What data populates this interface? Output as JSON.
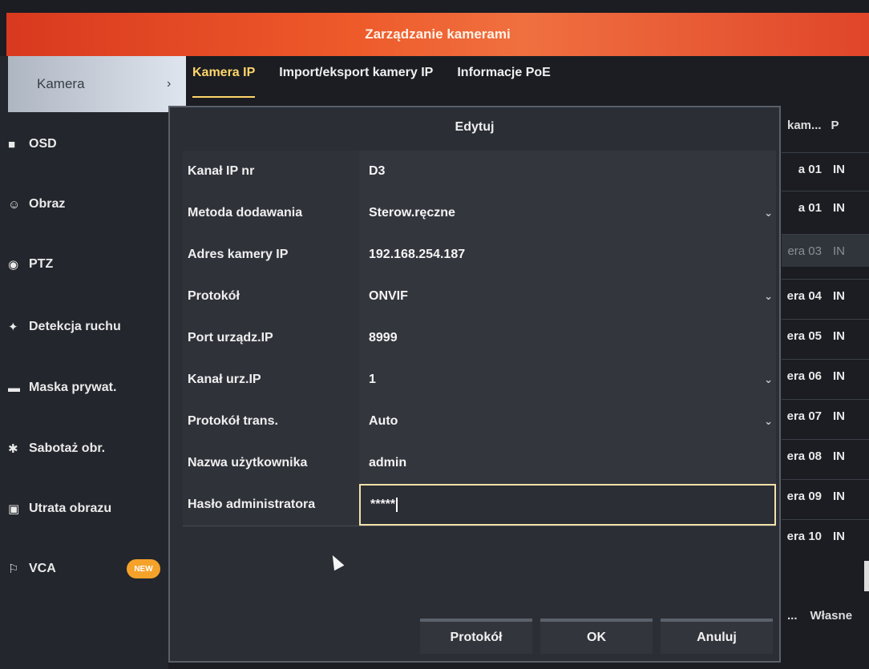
{
  "window": {
    "title": "Zarządzanie kamerami"
  },
  "sidebar": {
    "active": {
      "label": "Kamera",
      "chevron": "›"
    },
    "items": [
      {
        "label": "OSD",
        "icon": "osd-icon",
        "glyph": "■"
      },
      {
        "label": "Obraz",
        "icon": "image-icon",
        "glyph": "☺"
      },
      {
        "label": "PTZ",
        "icon": "ptz-icon",
        "glyph": "◉"
      },
      {
        "label": "Detekcja ruchu",
        "icon": "motion-icon",
        "glyph": "✦"
      },
      {
        "label": "Maska prywat.",
        "icon": "privacy-mask-icon",
        "glyph": "▬"
      },
      {
        "label": "Sabotaż obr.",
        "icon": "tamper-icon",
        "glyph": "✱"
      },
      {
        "label": "Utrata obrazu",
        "icon": "video-loss-icon",
        "glyph": "▣"
      },
      {
        "label": "VCA",
        "icon": "vca-icon",
        "glyph": "⚐",
        "badge": "NEW"
      }
    ]
  },
  "tabs": [
    {
      "label": "Kamera IP",
      "active": true
    },
    {
      "label": "Import/eksport kamery IP",
      "active": false
    },
    {
      "label": "Informacje PoE",
      "active": false
    }
  ],
  "background_list": {
    "header": [
      "kam...",
      "P"
    ],
    "rows": [
      {
        "name": "a 01",
        "proto": "IN"
      },
      {
        "name": "a 01",
        "proto": "IN"
      },
      {
        "name": "era 03",
        "proto": "IN"
      },
      {
        "name": "era 04",
        "proto": "IN"
      },
      {
        "name": "era 05",
        "proto": "IN"
      },
      {
        "name": "era 06",
        "proto": "IN"
      },
      {
        "name": "era 07",
        "proto": "IN"
      },
      {
        "name": "era 08",
        "proto": "IN"
      },
      {
        "name": "era 09",
        "proto": "IN"
      },
      {
        "name": "era 10",
        "proto": "IN"
      }
    ],
    "footer": [
      "...",
      "Własne"
    ]
  },
  "dialog": {
    "title": "Edytuj",
    "fields": [
      {
        "label": "Kanał IP nr",
        "value": "D3",
        "dropdown": false
      },
      {
        "label": "Metoda dodawania",
        "value": "Sterow.ręczne",
        "dropdown": true
      },
      {
        "label": "Adres kamery IP",
        "value": "192.168.254.187",
        "dropdown": false
      },
      {
        "label": "Protokół",
        "value": "ONVIF",
        "dropdown": true
      },
      {
        "label": "Port urządz.IP",
        "value": "8999",
        "dropdown": false
      },
      {
        "label": "Kanał urz.IP",
        "value": "1",
        "dropdown": true
      },
      {
        "label": "Protokół trans.",
        "value": "Auto",
        "dropdown": true
      },
      {
        "label": "Nazwa użytkownika",
        "value": "admin",
        "dropdown": false
      },
      {
        "label": "Hasło administratora",
        "value": "*****",
        "dropdown": false,
        "focused": true
      }
    ],
    "buttons": {
      "protocol": "Protokół",
      "ok": "OK",
      "cancel": "Anuluj"
    }
  },
  "icons": {
    "dropdown": "⌄"
  },
  "colors": {
    "title_bar": "#e34a26",
    "active_tab": "#ffd56a",
    "badge": "#f5a22a"
  }
}
